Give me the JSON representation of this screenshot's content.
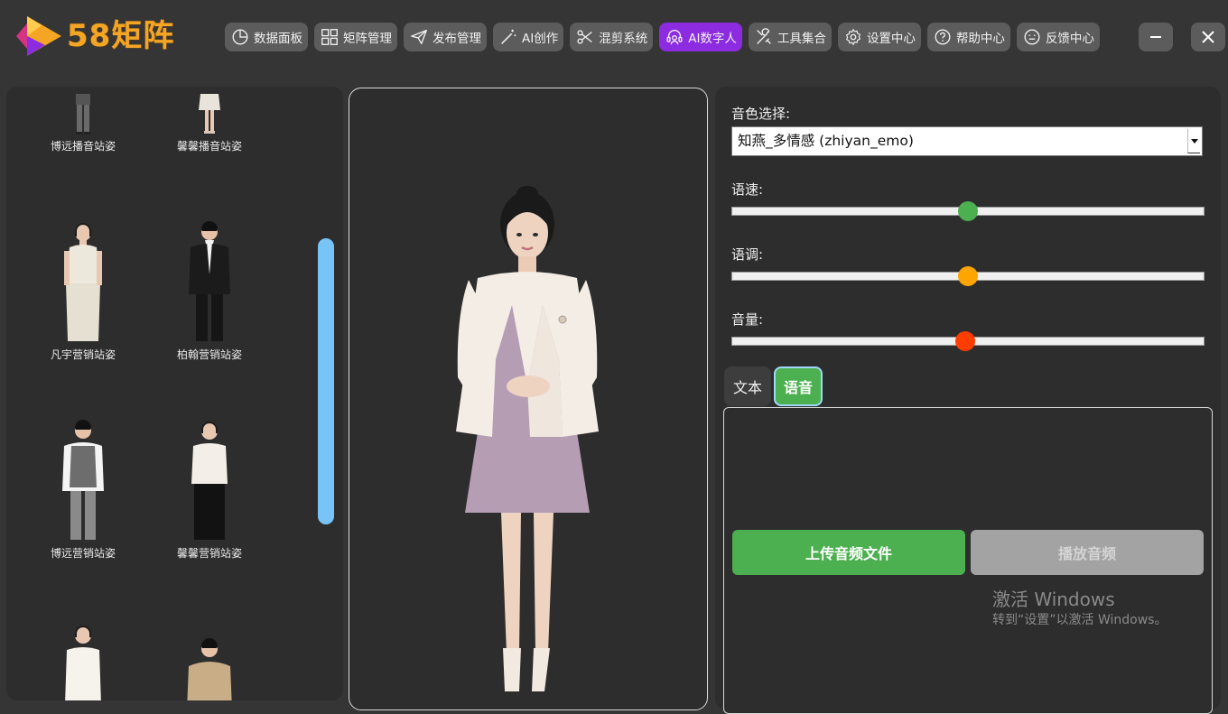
{
  "app": {
    "logo_text": "58矩阵",
    "brand_color": "#f5a524",
    "accent_color": "#8c2be0"
  },
  "nav": [
    {
      "label": "数据面板",
      "icon": "pie-chart-icon",
      "active": false
    },
    {
      "label": "矩阵管理",
      "icon": "grid-icon",
      "active": false
    },
    {
      "label": "发布管理",
      "icon": "send-icon",
      "active": false
    },
    {
      "label": "AI创作",
      "icon": "magic-wand-icon",
      "active": false
    },
    {
      "label": "混剪系统",
      "icon": "scissors-icon",
      "active": false
    },
    {
      "label": "AI数字人",
      "icon": "headset-avatar-icon",
      "active": true
    },
    {
      "label": "工具集合",
      "icon": "tools-icon",
      "active": false
    },
    {
      "label": "设置中心",
      "icon": "gear-icon",
      "active": false
    },
    {
      "label": "帮助中心",
      "icon": "help-icon",
      "active": false
    },
    {
      "label": "反馈中心",
      "icon": "smiley-icon",
      "active": false
    }
  ],
  "window_controls": {
    "minimize_icon": "minimize-icon",
    "close_icon": "close-icon"
  },
  "avatars": [
    {
      "label": "博远播音站姿"
    },
    {
      "label": "馨馨播音站姿"
    },
    {
      "label": "凡宇营销站姿"
    },
    {
      "label": "柏翰营销站姿"
    },
    {
      "label": "博远营销站姿"
    },
    {
      "label": "馨馨营销站姿"
    },
    {
      "label": ""
    },
    {
      "label": ""
    }
  ],
  "settings": {
    "voice_label": "音色选择:",
    "voice_value": "知燕_多情感 (zhiyan_emo)",
    "speed_label": "语速:",
    "speed_value": 0.5,
    "speed_color": "#4caf50",
    "pitch_label": "语调:",
    "pitch_value": 0.5,
    "pitch_color": "#ffa500",
    "volume_label": "音量:",
    "volume_value": 0.495,
    "volume_color": "#ff3d00"
  },
  "tabs": {
    "text_label": "文本",
    "voice_label": "语音",
    "active": "voice"
  },
  "audio": {
    "upload_label": "上传音频文件",
    "play_label": "播放音频"
  },
  "watermark": {
    "line1": "激活 Windows",
    "line2": "转到“设置”以激活 Windows。"
  }
}
